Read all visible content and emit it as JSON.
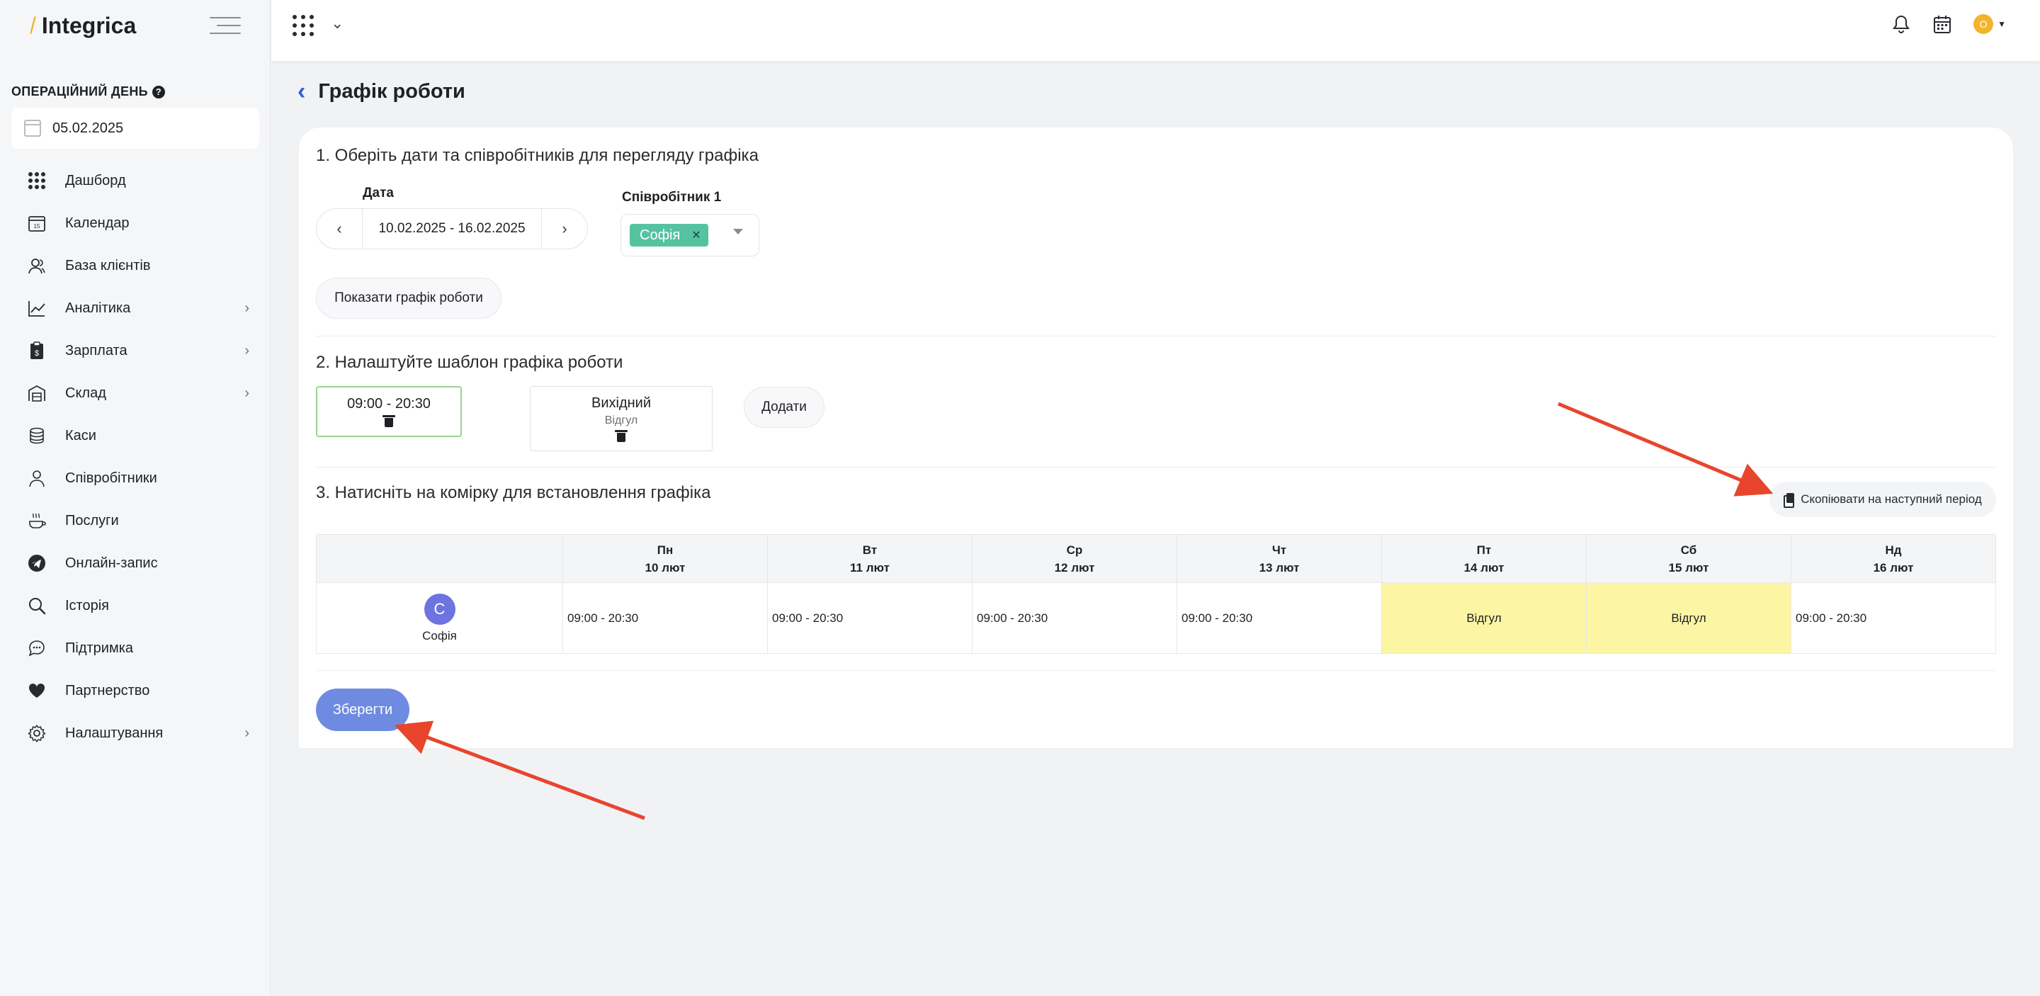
{
  "app": {
    "logo": "Integrica"
  },
  "sidebar": {
    "op_day_label": "ОПЕРАЦІЙНИЙ ДЕНЬ",
    "op_day_help": "?",
    "op_date": "05.02.2025",
    "items": [
      {
        "label": "Дашборд",
        "icon": "dashboard-icon"
      },
      {
        "label": "Календар",
        "icon": "calendar-icon"
      },
      {
        "label": "База клієнтів",
        "icon": "clients-icon"
      },
      {
        "label": "Аналітика",
        "icon": "analytics-icon"
      },
      {
        "label": "Зарплата",
        "icon": "salary-icon"
      },
      {
        "label": "Склад",
        "icon": "warehouse-icon"
      },
      {
        "label": "Каси",
        "icon": "cash-icon"
      },
      {
        "label": "Співробітники",
        "icon": "employees-icon"
      },
      {
        "label": "Послуги",
        "icon": "services-icon"
      },
      {
        "label": "Онлайн-запис",
        "icon": "telegram-icon"
      },
      {
        "label": "Історія",
        "icon": "search-icon"
      },
      {
        "label": "Підтримка",
        "icon": "support-icon"
      },
      {
        "label": "Партнерство",
        "icon": "heart-icon"
      },
      {
        "label": "Налаштування",
        "icon": "gear-icon"
      }
    ]
  },
  "topbar": {
    "avatar_initial": "О"
  },
  "page": {
    "title": "Графік роботи",
    "step1": {
      "title": "1. Оберіть дати та співробітників для перегляду графіка",
      "date_label": "Дата",
      "date_range": "10.02.2025 - 16.02.2025",
      "employee_label": "Співробітник 1",
      "employee_chip": "Софія",
      "show_button": "Показати графік роботи"
    },
    "step2": {
      "title": "2. Налаштуйте шаблон графіка роботи",
      "template_work": "09:00 - 20:30",
      "template_off_title": "Вихідний",
      "template_off_sub": "Відгул",
      "add_button": "Додати"
    },
    "step3": {
      "title": "3. Натисніть на комірку для встановлення графіка",
      "copy_button": "Скопіювати на наступний період"
    },
    "schedule": {
      "days": [
        {
          "dow": "Пн",
          "date": "10 лют"
        },
        {
          "dow": "Вт",
          "date": "11 лют"
        },
        {
          "dow": "Ср",
          "date": "12 лют"
        },
        {
          "dow": "Чт",
          "date": "13 лют"
        },
        {
          "dow": "Пт",
          "date": "14 лют"
        },
        {
          "dow": "Сб",
          "date": "15 лют"
        },
        {
          "dow": "Нд",
          "date": "16 лют"
        }
      ],
      "employee": {
        "initial": "С",
        "name": "Софія"
      },
      "cells": [
        "09:00 - 20:30",
        "09:00 - 20:30",
        "09:00 - 20:30",
        "09:00 - 20:30",
        "Відгул",
        "Відгул",
        "09:00 - 20:30"
      ]
    },
    "save_button": "Зберегти"
  },
  "colors": {
    "accent": "#2f5be4",
    "save": "#6f8be1",
    "chip": "#55c2a0",
    "off_day": "#fbf5a4",
    "annotation_arrow": "#e8452c"
  }
}
